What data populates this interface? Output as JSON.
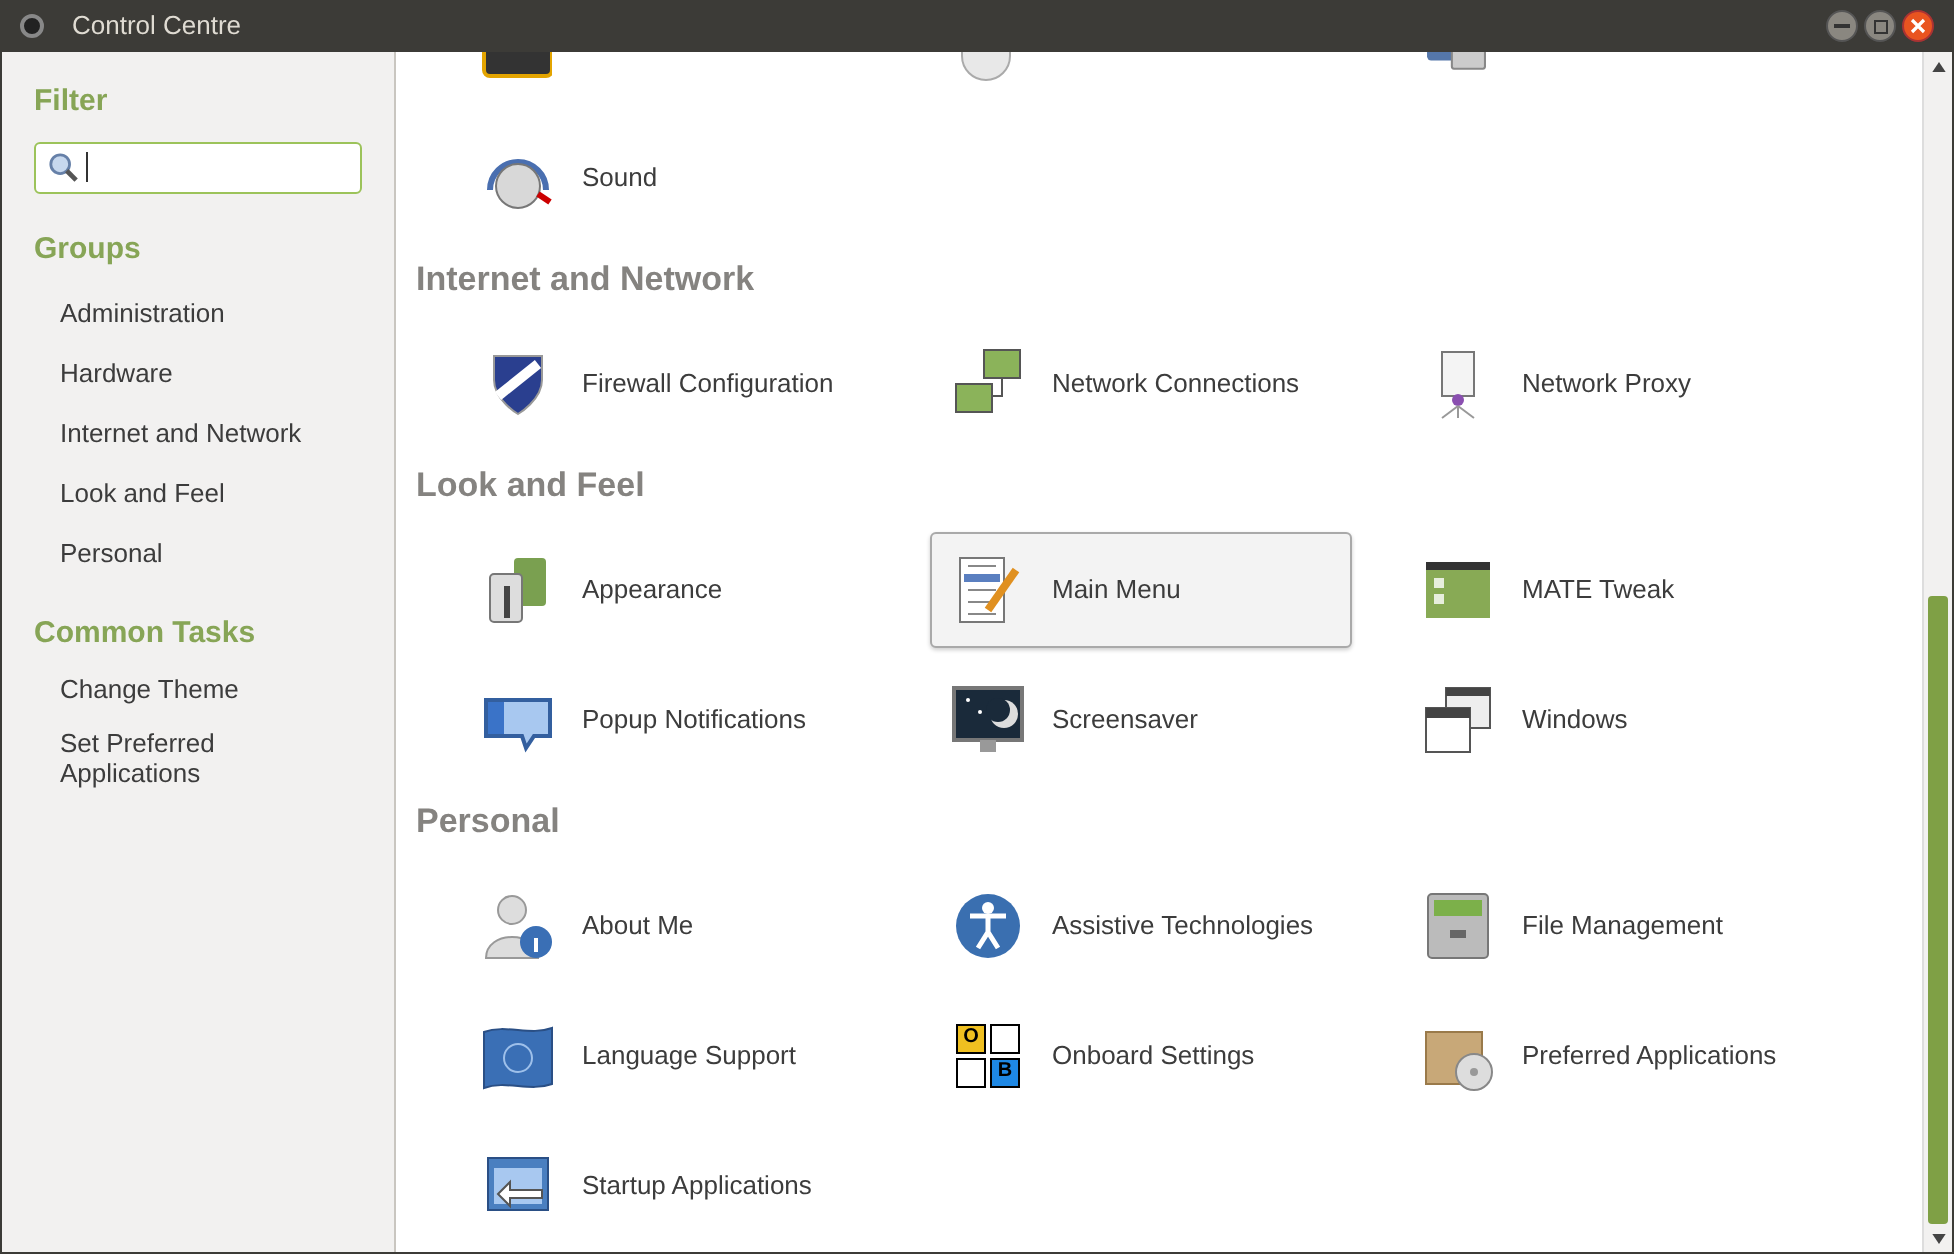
{
  "window": {
    "title": "Control Centre"
  },
  "sidebar": {
    "filter_heading": "Filter",
    "groups_heading": "Groups",
    "groups": [
      {
        "label": "Administration"
      },
      {
        "label": "Hardware"
      },
      {
        "label": "Internet and Network"
      },
      {
        "label": "Look and Feel"
      },
      {
        "label": "Personal"
      }
    ],
    "tasks_heading": "Common Tasks",
    "tasks": [
      {
        "label": "Change Theme"
      },
      {
        "label": "Set Preferred Applications"
      }
    ]
  },
  "sections": [
    {
      "items": [
        {
          "kind": "keyboard"
        },
        {
          "kind": "mouse"
        },
        {
          "kind": "power"
        }
      ]
    },
    {
      "items": [
        {
          "kind": "sound",
          "label": "Sound",
          "selected": false
        }
      ]
    },
    {
      "heading": "Internet and Network",
      "items": [
        {
          "kind": "shield",
          "label": "Firewall Configuration",
          "selected": false
        },
        {
          "kind": "network",
          "label": "Network Connections",
          "selected": false
        },
        {
          "kind": "proxy",
          "label": "Network Proxy",
          "selected": false
        }
      ]
    },
    {
      "heading": "Look and Feel",
      "items": [
        {
          "kind": "appearance",
          "label": "Appearance",
          "selected": false
        },
        {
          "kind": "menu",
          "label": "Main Menu",
          "selected": true
        },
        {
          "kind": "tweak",
          "label": "MATE Tweak",
          "selected": false
        },
        {
          "kind": "popup",
          "label": "Popup Notifications",
          "selected": false
        },
        {
          "kind": "screensaver",
          "label": "Screensaver",
          "selected": false
        },
        {
          "kind": "windows",
          "label": "Windows",
          "selected": false
        }
      ]
    },
    {
      "heading": "Personal",
      "items": [
        {
          "kind": "person",
          "label": "About Me",
          "selected": false
        },
        {
          "kind": "accessibility",
          "label": "Assistive Technologies",
          "selected": false
        },
        {
          "kind": "cabinet",
          "label": "File Management",
          "selected": false
        },
        {
          "kind": "flag",
          "label": "Language Support",
          "selected": false
        },
        {
          "kind": "onboard",
          "label": "Onboard Settings",
          "icon_text": [
            "O",
            "B"
          ],
          "selected": false
        },
        {
          "kind": "package",
          "label": "Preferred Applications",
          "selected": false
        },
        {
          "kind": "startup",
          "label": "Startup Applications",
          "selected": false
        }
      ]
    }
  ]
}
